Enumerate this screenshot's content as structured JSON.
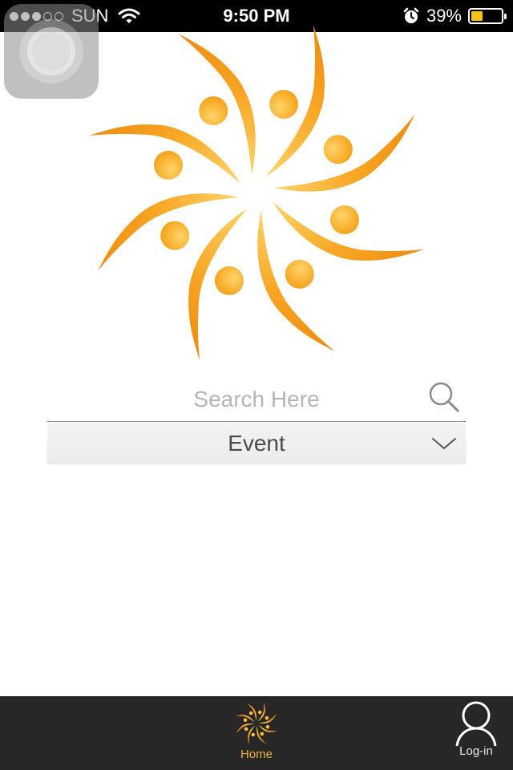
{
  "status_bar": {
    "carrier": "SUN",
    "signal_bars_filled": 3,
    "signal_bars_total": 5,
    "time": "9:50 PM",
    "battery_percent": "39%",
    "battery_level": 0.39,
    "icons": [
      "wifi-icon",
      "alarm-icon",
      "battery-icon"
    ]
  },
  "logo": {
    "icon": "sun-flower-logo",
    "colors": {
      "petal": "#f7a21b",
      "highlight": "#ffd46a"
    }
  },
  "search": {
    "placeholder": "Search Here",
    "value": "",
    "icon": "search-icon"
  },
  "category_select": {
    "selected": "Event",
    "icon": "chevron-down-icon"
  },
  "tab_bar": {
    "tabs": [
      {
        "label": "Home",
        "icon": "sun-flower-icon",
        "active": true,
        "color": "#f0b23a"
      },
      {
        "label": "Log-in",
        "icon": "user-icon",
        "active": false,
        "color": "#e8e8e8"
      }
    ]
  }
}
